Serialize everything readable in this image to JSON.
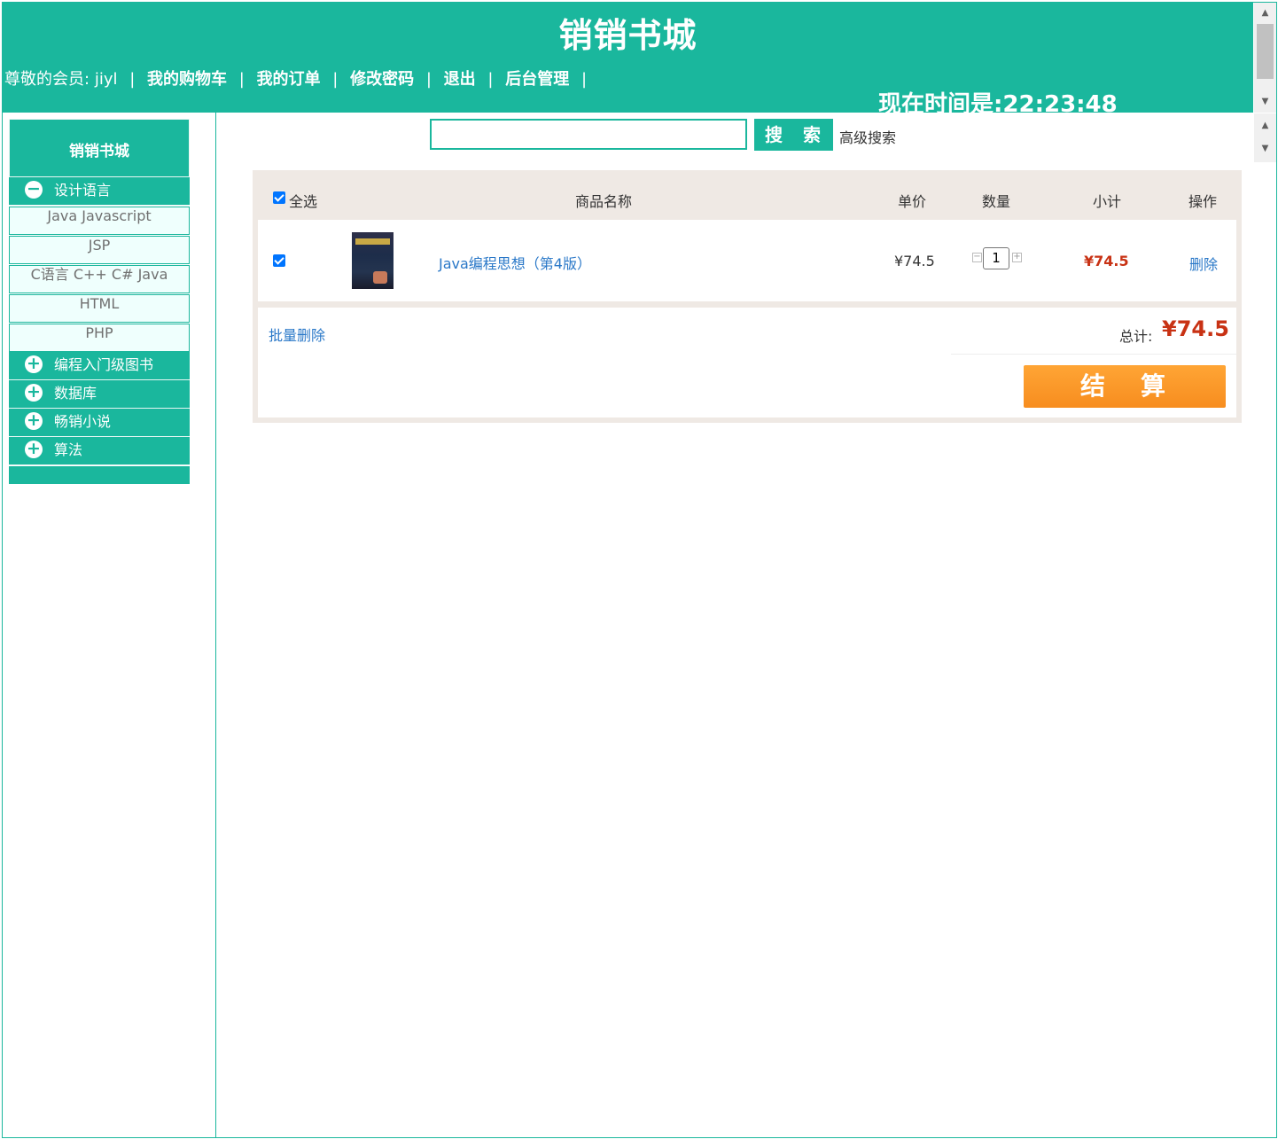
{
  "header": {
    "title": "销销书城",
    "greeting": "尊敬的会员:",
    "username": "jiyl",
    "nav": [
      "我的购物车",
      "我的订单",
      "修改密码",
      "退出",
      "后台管理"
    ],
    "separator": "|",
    "clock_label": "现在时间是:22:23:48"
  },
  "sidebar": {
    "title": "销销书城",
    "categories": [
      {
        "label": "设计语言",
        "icon": "minus-circle-icon",
        "expanded": true,
        "items": [
          "Java Javascript",
          "JSP",
          "C语言 C++ C# Java",
          "HTML",
          "PHP"
        ]
      },
      {
        "label": "编程入门级图书",
        "icon": "plus-circle-icon"
      },
      {
        "label": "数据库",
        "icon": "plus-circle-icon"
      },
      {
        "label": "畅销小说",
        "icon": "plus-circle-icon"
      },
      {
        "label": "算法",
        "icon": "plus-circle-icon"
      }
    ]
  },
  "search": {
    "placeholder": "",
    "button_label": "搜 索",
    "advanced_label": "高级搜索"
  },
  "cart": {
    "columns": {
      "select_all": "全选",
      "name": "商品名称",
      "price": "单价",
      "qty": "数量",
      "subtotal": "小计",
      "action": "操作"
    },
    "items": [
      {
        "name": "Java编程思想（第4版）",
        "price": "¥74.5",
        "qty": "1",
        "subtotal": "¥74.5",
        "action": "删除",
        "checked": true
      }
    ],
    "batch_delete": "批量删除",
    "total_label": "总计:",
    "total_value": "¥74.5",
    "checkout_label": "结算"
  },
  "colors": {
    "brand": "#1ab79d",
    "price": "#c83214",
    "link": "#2a78c8",
    "checkout": "#f78d1f"
  }
}
